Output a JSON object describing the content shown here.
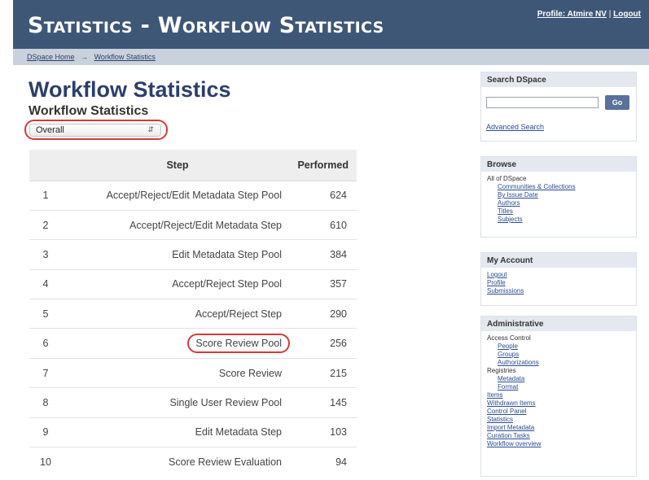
{
  "header": {
    "title": "Statistics - Workflow Statistics",
    "profile_link": "Profile: Atmire NV",
    "separator": "|",
    "logout_link": "Logout"
  },
  "breadcrumb": {
    "home": "DSpace Home",
    "arrow": "→",
    "current": "Workflow Statistics"
  },
  "main": {
    "title": "Workflow Statistics",
    "subtitle": "Workflow Statistics",
    "filter_value": "Overall",
    "table": {
      "columns": [
        "",
        "Step",
        "Performed"
      ],
      "rows": [
        {
          "num": "1",
          "step": "Accept/Reject/Edit Metadata Step Pool",
          "performed": "624"
        },
        {
          "num": "2",
          "step": "Accept/Reject/Edit Metadata Step",
          "performed": "610"
        },
        {
          "num": "3",
          "step": "Edit Metadata Step Pool",
          "performed": "384"
        },
        {
          "num": "4",
          "step": "Accept/Reject Step Pool",
          "performed": "357"
        },
        {
          "num": "5",
          "step": "Accept/Reject Step",
          "performed": "290"
        },
        {
          "num": "6",
          "step": "Score Review Pool",
          "performed": "256"
        },
        {
          "num": "7",
          "step": "Score Review",
          "performed": "215"
        },
        {
          "num": "8",
          "step": "Single User Review Pool",
          "performed": "145"
        },
        {
          "num": "9",
          "step": "Edit Metadata Step",
          "performed": "103"
        },
        {
          "num": "10",
          "step": "Score Review Evaluation",
          "performed": "94"
        }
      ]
    }
  },
  "sidebar": {
    "search": {
      "title": "Search DSpace",
      "go_label": "Go",
      "advanced_link": "Advanced Search"
    },
    "browse": {
      "title": "Browse",
      "scope": "All of DSpace",
      "links": [
        "Communities & Collections",
        "By Issue Date",
        "Authors",
        "Titles",
        "Subjects"
      ]
    },
    "account": {
      "title": "My Account",
      "links": [
        "Logout",
        "Profile",
        "Submissions"
      ]
    },
    "admin": {
      "title": "Administrative",
      "access_control": "Access Control",
      "access_links": [
        "People",
        "Groups",
        "Authorizations"
      ],
      "registries": "Registries",
      "registry_links": [
        "Metadata",
        "Format"
      ],
      "links": [
        "Items",
        "Withdrawn Items",
        "Control Panel",
        "Statistics",
        "Import Metadata",
        "Curation Tasks",
        "Workflow overview"
      ]
    }
  }
}
